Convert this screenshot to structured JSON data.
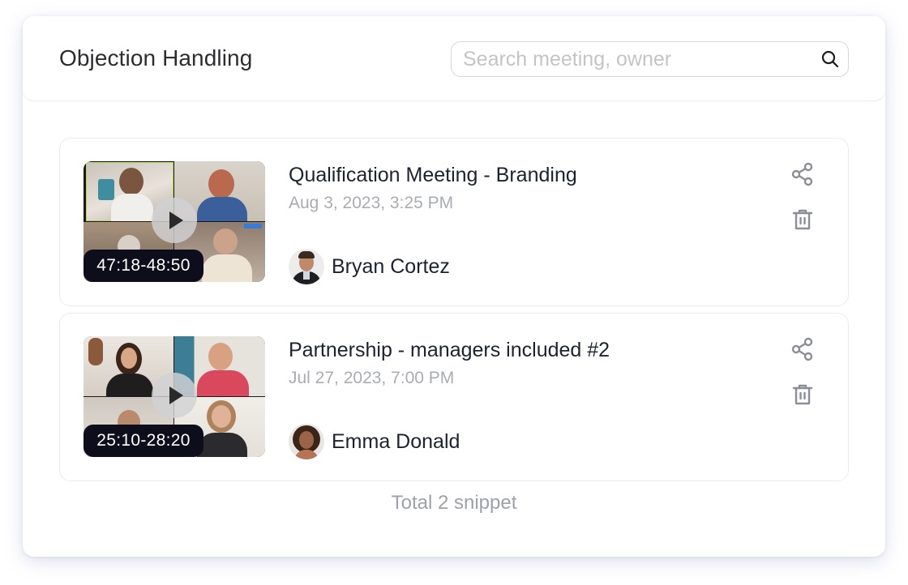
{
  "header": {
    "title": "Objection Handling",
    "search": {
      "placeholder": "Search meeting, owner",
      "value": "",
      "icon": "search-icon"
    }
  },
  "snippets": [
    {
      "title": "Qualification Meeting - Branding",
      "date": "Aug 3, 2023, 3:25 PM",
      "duration": "47:18-48:50",
      "owner": "Bryan Cortez",
      "thumbnail_icon": "video-call-grid-thumbnail",
      "actions": [
        "share-icon",
        "trash-icon"
      ]
    },
    {
      "title": "Partnership - managers included #2",
      "date": "Jul 27, 2023, 7:00 PM",
      "duration": "25:10-28:20",
      "owner": "Emma Donald",
      "thumbnail_icon": "video-call-grid-thumbnail",
      "actions": [
        "share-icon",
        "trash-icon"
      ]
    }
  ],
  "footer": {
    "total": "Total 2 snippet"
  },
  "colors": {
    "title_text": "#2b2d31",
    "meta_text": "#a9acb3",
    "icon_gray": "#8b8e96",
    "duration_badge": "#0d0d1c"
  }
}
